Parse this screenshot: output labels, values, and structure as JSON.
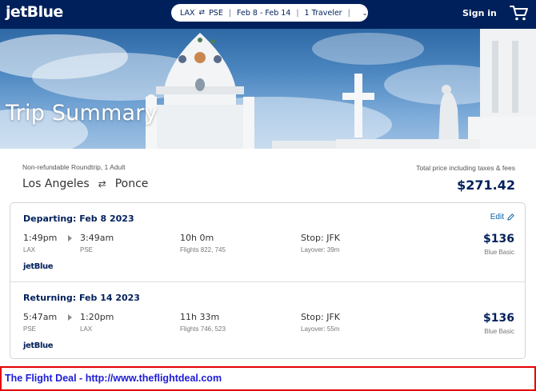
{
  "header": {
    "logo": "jetBlue",
    "search": {
      "origin": "LAX",
      "destination": "PSE",
      "dates": "Feb 8 - Feb 14",
      "travelers": "1 Traveler",
      "swap_icon": "swap-arrows-icon",
      "dropdown_icon": "chevron-down-icon"
    },
    "sign_in": "Sign in",
    "cart_icon": "cart-icon"
  },
  "hero": {
    "title": "Trip Summary"
  },
  "summary": {
    "fare_type": "Non-refundable Roundtrip, 1 Adult",
    "origin_city": "Los Angeles",
    "destination_city": "Ponce",
    "total_label": "Total price including taxes & fees",
    "total_price": "$271.42"
  },
  "legs": [
    {
      "title": "Departing: Feb 8 2023",
      "edit_label": "Edit",
      "depart_time": "1:49pm",
      "depart_code": "LAX",
      "arrive_time": "3:49am",
      "arrive_code": "PSE",
      "duration": "10h 0m",
      "flights": "Flights 822, 745",
      "stop": "Stop: JFK",
      "layover": "Layover: 39m",
      "price": "$136",
      "cabin": "Blue Basic",
      "carrier": "jetBlue"
    },
    {
      "title": "Returning: Feb 14 2023",
      "depart_time": "5:47am",
      "depart_code": "PSE",
      "arrive_time": "1:20pm",
      "arrive_code": "LAX",
      "duration": "11h 33m",
      "flights": "Flights 746, 523",
      "stop": "Stop: JFK",
      "layover": "Layover: 55m",
      "price": "$136",
      "cabin": "Blue Basic",
      "carrier": "jetBlue"
    }
  ],
  "banner": {
    "text": "The Flight Deal - http://www.theflightdeal.com"
  },
  "colors": {
    "navy": "#00205b",
    "link": "#0b5fa5",
    "banner_border": "#e30000",
    "banner_text": "#1c1cd8"
  }
}
